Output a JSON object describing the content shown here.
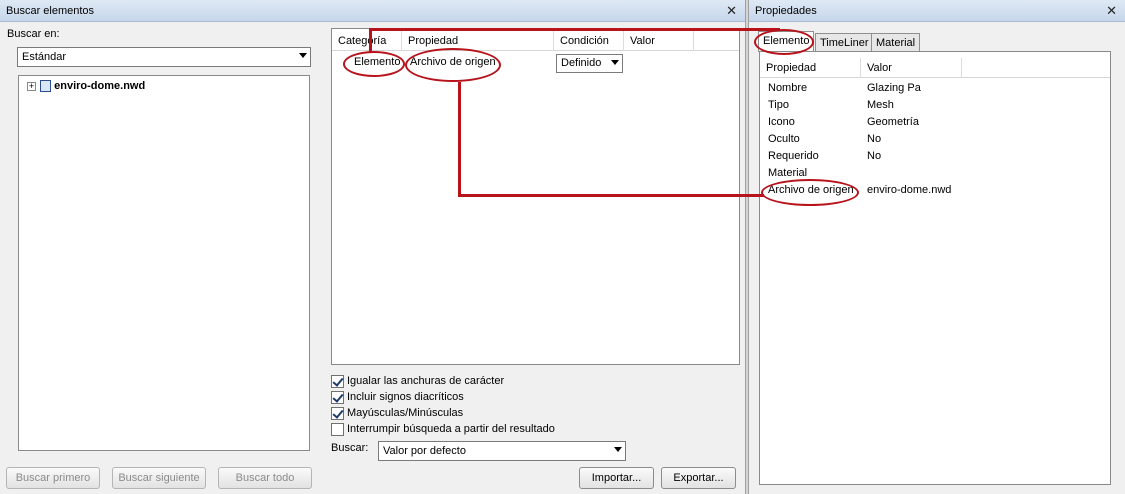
{
  "find_window": {
    "title": "Buscar elementos",
    "search_in_label": "Buscar en:",
    "search_in_value": "Estándar",
    "tree_item": "enviro-dome.nwd",
    "columns": [
      "Categoría",
      "Propiedad",
      "Condición",
      "Valor"
    ],
    "row": {
      "category": "Elemento",
      "property": "Archivo de origen",
      "condition": "Definido",
      "value": ""
    },
    "options": [
      {
        "label": "Igualar las anchuras de carácter",
        "checked": true
      },
      {
        "label": "Incluir signos diacríticos",
        "checked": true
      },
      {
        "label": "Mayúsculas/Minúsculas",
        "checked": true
      },
      {
        "label": "Interrumpir búsqueda a partir del resultado",
        "checked": false
      }
    ],
    "search_label": "Buscar:",
    "search_value": "Valor por defecto",
    "buttons": {
      "find_first": "Buscar primero",
      "find_next": "Buscar siguiente",
      "find_all": "Buscar todo",
      "import": "Importar...",
      "export": "Exportar..."
    }
  },
  "properties_window": {
    "title": "Propiedades",
    "tabs": [
      "Elemento",
      "TimeLiner",
      "Material"
    ],
    "active_tab": "Elemento",
    "columns": [
      "Propiedad",
      "Valor"
    ],
    "rows": [
      {
        "name": "Nombre",
        "value": "Glazing Pa"
      },
      {
        "name": "Tipo",
        "value": "Mesh"
      },
      {
        "name": "Icono",
        "value": "Geometría"
      },
      {
        "name": "Oculto",
        "value": "No"
      },
      {
        "name": "Requerido",
        "value": "No"
      },
      {
        "name": "Material",
        "value": ""
      },
      {
        "name": "Archivo de origen",
        "value": "enviro-dome.nwd"
      }
    ]
  },
  "colors": {
    "annotation": "#b8121b",
    "titlebar": "#c6d6ea"
  }
}
